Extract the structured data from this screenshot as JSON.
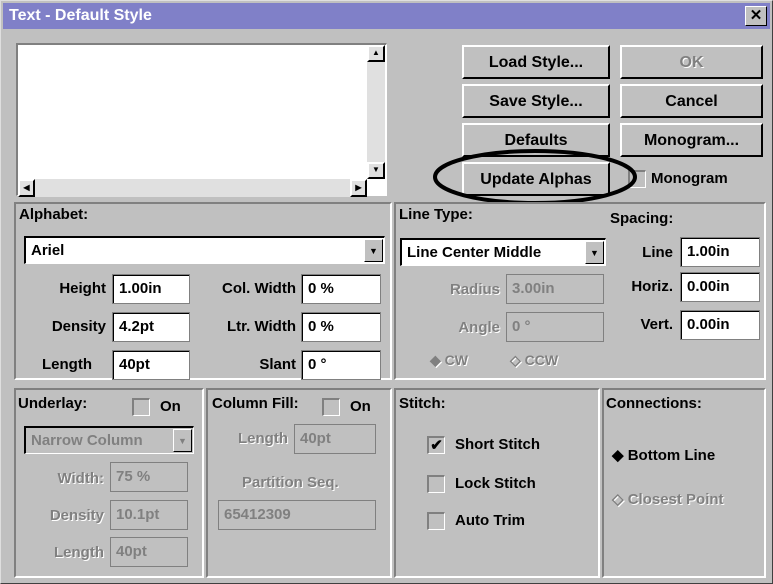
{
  "window": {
    "title": "Text - Default Style",
    "close_glyph": "✕"
  },
  "preview_text": "",
  "buttons": {
    "load_style": "Load Style...",
    "ok": "OK",
    "save_style": "Save Style...",
    "cancel": "Cancel",
    "defaults": "Defaults",
    "monogram": "Monogram...",
    "update_alphas": "Update Alphas"
  },
  "monogram_checkbox": {
    "label": "Monogram",
    "checked": false
  },
  "alphabet": {
    "header": "Alphabet:",
    "font": "Ariel",
    "height_label": "Height",
    "height": "1.00in",
    "col_width_label": "Col. Width",
    "col_width": "0 %",
    "density_label": "Density",
    "density": "4.2pt",
    "ltr_width_label": "Ltr. Width",
    "ltr_width": "0 %",
    "length_label": "Length",
    "length": "40pt",
    "slant_label": "Slant",
    "slant": "0 °"
  },
  "line_type": {
    "header": "Line Type:",
    "value": "Line Center Middle",
    "radius_label": "Radius",
    "radius": "3.00in",
    "angle_label": "Angle",
    "angle": "0 °",
    "cw_label": "CW",
    "ccw_label": "CCW"
  },
  "spacing": {
    "header": "Spacing:",
    "line_label": "Line",
    "line": "1.00in",
    "horiz_label": "Horiz.",
    "horiz": "0.00in",
    "vert_label": "Vert.",
    "vert": "0.00in"
  },
  "underlay": {
    "header": "Underlay:",
    "on_label": "On",
    "type": "Narrow Column",
    "width_label": "Width:",
    "width": "75 %",
    "density_label": "Density",
    "density": "10.1pt",
    "length_label": "Length",
    "length": "40pt"
  },
  "column_fill": {
    "header": "Column Fill:",
    "on_label": "On",
    "length_label": "Length",
    "length": "40pt",
    "partition_label": "Partition Seq.",
    "partition": "65412309"
  },
  "stitch": {
    "header": "Stitch:",
    "short_stitch": "Short Stitch",
    "short_checked": "✔",
    "lock_stitch": "Lock Stitch",
    "auto_trim": "Auto Trim"
  },
  "connections": {
    "header": "Connections:",
    "bottom_line": "Bottom Line",
    "closest_point": "Closest Point"
  },
  "colors": {
    "titlebar": "#8080c8",
    "face": "#c0c0c0",
    "annotation": "#000000"
  }
}
